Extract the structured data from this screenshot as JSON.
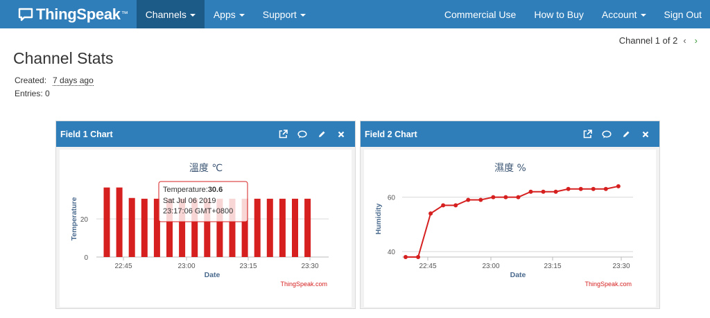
{
  "navbar": {
    "brand": "ThingSpeak",
    "tm": "™",
    "left_items": [
      {
        "label": "Channels",
        "active": true,
        "dropdown": true
      },
      {
        "label": "Apps",
        "active": false,
        "dropdown": true
      },
      {
        "label": "Support",
        "active": false,
        "dropdown": true
      }
    ],
    "right_items": [
      {
        "label": "Commercial Use",
        "dropdown": false
      },
      {
        "label": "How to Buy",
        "dropdown": false
      },
      {
        "label": "Account",
        "dropdown": true
      },
      {
        "label": "Sign Out",
        "dropdown": false
      }
    ]
  },
  "page": {
    "title": "Channel Stats",
    "channel_nav": "Channel 1 of 2",
    "prev_icon": "chevron-left-icon",
    "next_icon": "chevron-right-icon",
    "created_label": "Created:",
    "created_value": "7 days ago",
    "entries_label": "Entries:",
    "entries_value": "0"
  },
  "colors": {
    "nav_blue": "#2f7eb9",
    "nav_active": "#1c5a87",
    "series_red": "#d62020",
    "axis_title": "#4a6a8e"
  },
  "panels": [
    {
      "title": "Field 1 Chart",
      "icons": [
        "external-link-icon",
        "comment-icon",
        "pencil-icon",
        "close-icon"
      ]
    },
    {
      "title": "Field 2 Chart",
      "icons": [
        "external-link-icon",
        "comment-icon",
        "pencil-icon",
        "close-icon"
      ]
    }
  ],
  "chart_data": [
    {
      "type": "bar",
      "title": "溫度 ℃",
      "xlabel": "Date",
      "ylabel": "Temperature",
      "x_ticks": [
        "22:45",
        "23:00",
        "23:15",
        "23:30"
      ],
      "y_ticks": [
        0,
        20
      ],
      "ylim": [
        0,
        40
      ],
      "credit": "ThingSpeak.com",
      "series": [
        {
          "name": "Temperature",
          "values": [
            36.5,
            36.5,
            31,
            30.6,
            30.6,
            30.6,
            30.6,
            30.6,
            30.6,
            30.6,
            30.6,
            30.6,
            30.6,
            30.6,
            30.6,
            30.6,
            30.6
          ]
        }
      ],
      "tooltip": {
        "series_label": "Temperature:",
        "value": "30.6",
        "date": "Sat Jul 06 2019",
        "time": "23:17:06 GMT+0800"
      },
      "highlighted_bar_index": 5
    },
    {
      "type": "line",
      "title": "濕度 %",
      "xlabel": "Date",
      "ylabel": "Humidity",
      "x_ticks": [
        "22:45",
        "23:00",
        "23:15",
        "23:30"
      ],
      "y_ticks": [
        40,
        60
      ],
      "ylim": [
        38,
        66
      ],
      "credit": "ThingSpeak.com",
      "series": [
        {
          "name": "Humidity",
          "values": [
            38,
            38,
            54,
            57,
            57,
            59,
            59,
            60,
            60,
            60,
            62,
            62,
            62,
            63,
            63,
            63,
            63,
            64
          ]
        }
      ]
    }
  ]
}
